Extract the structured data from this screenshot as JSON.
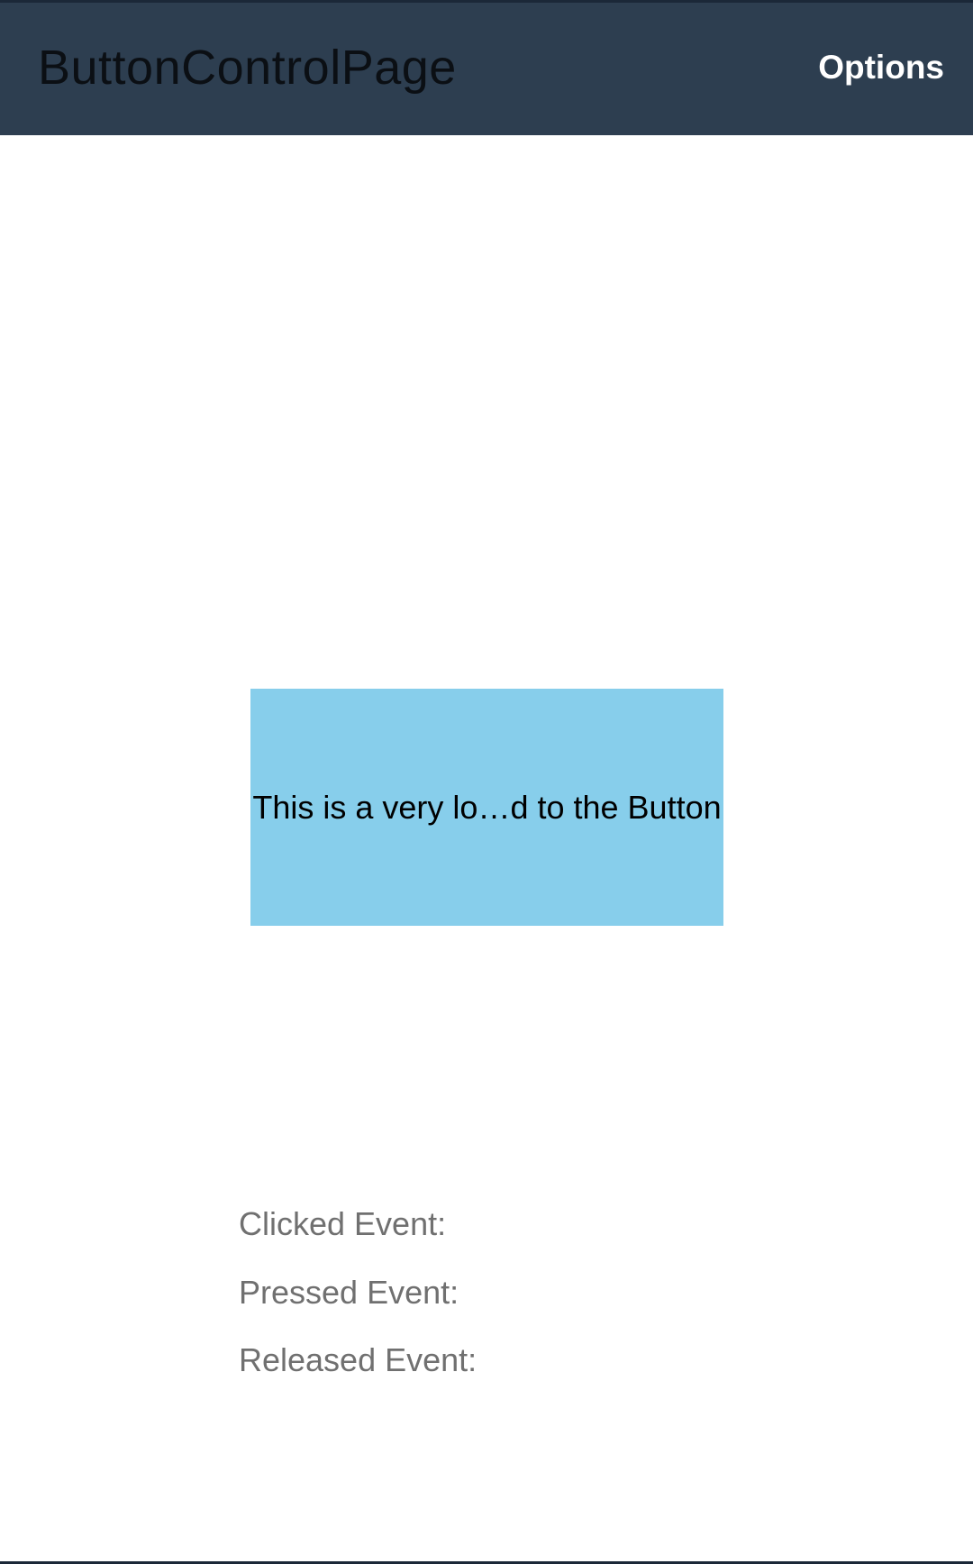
{
  "toolbar": {
    "title": "ButtonControlPage",
    "options_label": "Options"
  },
  "button": {
    "label": "This is a very lo…d to the Button",
    "background": "#87ceeb"
  },
  "events": {
    "clicked_label": "Clicked Event:",
    "pressed_label": "Pressed Event:",
    "released_label": "Released Event:"
  },
  "colors": {
    "toolbar_bg": "#2d3e50",
    "toolbar_title": "#0b0f14",
    "options_text": "#ffffff",
    "event_text": "#707070"
  }
}
